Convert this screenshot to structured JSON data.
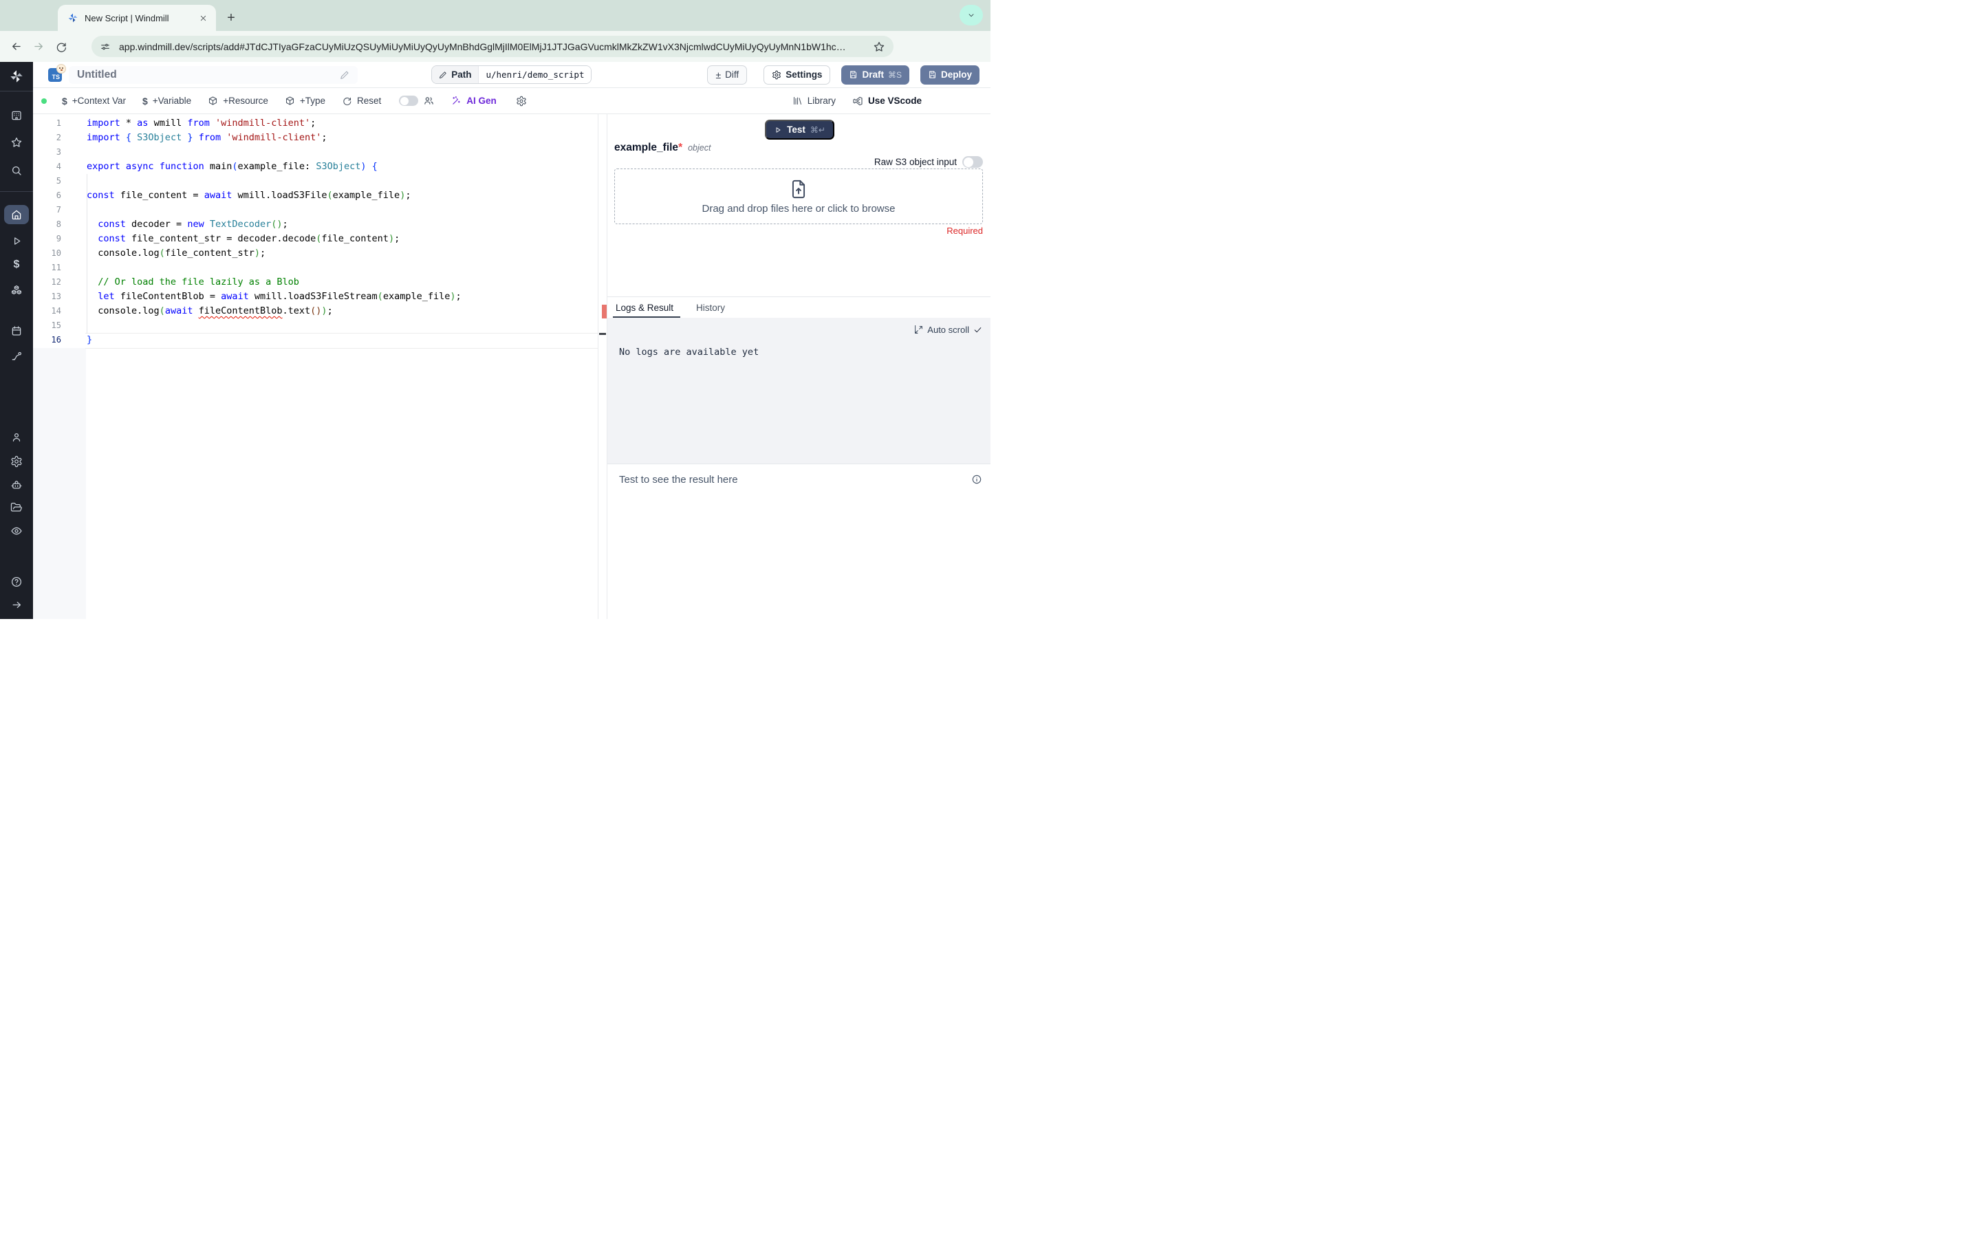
{
  "browser": {
    "tab_title": "New Script | Windmill",
    "url": "app.windmill.dev/scripts/add#JTdCJTIyaGFzaCUyMiUzQSUyMiUyMiUyQyUyMnBhdGglMjIlM0ElMjJ1JTJGaGVucmklMkZkZW1vX3NjcmlwdCUyMiUyQyUyMnN1bW1hc…"
  },
  "header": {
    "language_badge": "TS",
    "title": "Untitled",
    "path_label": "Path",
    "path_value": "u/henri/demo_script",
    "diff_label": "Diff",
    "settings_label": "Settings",
    "draft_label": "Draft",
    "draft_shortcut": "⌘S",
    "deploy_label": "Deploy"
  },
  "toolbar": {
    "context_var": "+Context Var",
    "variable": "+Variable",
    "resource": "+Resource",
    "type": "+Type",
    "reset": "Reset",
    "ai_gen": "AI Gen",
    "library": "Library",
    "vscode": "Use VScode"
  },
  "editor": {
    "cursor_line": 16,
    "error_line": 14,
    "lines": [
      [
        [
          "kw",
          "import"
        ],
        [
          "def",
          " * "
        ],
        [
          "kw",
          "as"
        ],
        [
          "def",
          " wmill "
        ],
        [
          "kw",
          "from"
        ],
        [
          "def",
          " "
        ],
        [
          "str",
          "'windmill-client'"
        ],
        [
          "def",
          ";"
        ]
      ],
      [
        [
          "kw",
          "import"
        ],
        [
          "p1",
          " { "
        ],
        [
          "type",
          "S3Object"
        ],
        [
          "p1",
          " } "
        ],
        [
          "kw",
          "from"
        ],
        [
          "def",
          " "
        ],
        [
          "str",
          "'windmill-client'"
        ],
        [
          "def",
          ";"
        ]
      ],
      [],
      [
        [
          "kw",
          "export"
        ],
        [
          "def",
          " "
        ],
        [
          "kw",
          "async"
        ],
        [
          "def",
          " "
        ],
        [
          "kw",
          "function"
        ],
        [
          "def",
          " main"
        ],
        [
          "p1",
          "("
        ],
        [
          "def",
          "example_file: "
        ],
        [
          "type",
          "S3Object"
        ],
        [
          "p1",
          ")"
        ],
        [
          "def",
          " "
        ],
        [
          "p1",
          "{"
        ]
      ],
      [],
      [
        [
          "kw",
          "const"
        ],
        [
          "def",
          " file_content = "
        ],
        [
          "kw",
          "await"
        ],
        [
          "def",
          " wmill.loadS3File"
        ],
        [
          "p2",
          "("
        ],
        [
          "def",
          "example_file"
        ],
        [
          "p2",
          ")"
        ],
        [
          "def",
          ";"
        ]
      ],
      [],
      [
        [
          "def",
          "  "
        ],
        [
          "kw",
          "const"
        ],
        [
          "def",
          " decoder = "
        ],
        [
          "kw",
          "new"
        ],
        [
          "def",
          " "
        ],
        [
          "type",
          "TextDecoder"
        ],
        [
          "p2",
          "()"
        ],
        [
          "def",
          ";"
        ]
      ],
      [
        [
          "def",
          "  "
        ],
        [
          "kw",
          "const"
        ],
        [
          "def",
          " file_content_str = decoder.decode"
        ],
        [
          "p2",
          "("
        ],
        [
          "def",
          "file_content"
        ],
        [
          "p2",
          ")"
        ],
        [
          "def",
          ";"
        ]
      ],
      [
        [
          "def",
          "  console.log"
        ],
        [
          "p2",
          "("
        ],
        [
          "def",
          "file_content_str"
        ],
        [
          "p2",
          ")"
        ],
        [
          "def",
          ";"
        ]
      ],
      [],
      [
        [
          "def",
          "  "
        ],
        [
          "cmt",
          "// Or load the file lazily as a Blob"
        ]
      ],
      [
        [
          "def",
          "  "
        ],
        [
          "kw",
          "let"
        ],
        [
          "def",
          " fileContentBlob = "
        ],
        [
          "kw",
          "await"
        ],
        [
          "def",
          " wmill.loadS3FileStream"
        ],
        [
          "p2",
          "("
        ],
        [
          "def",
          "example_file"
        ],
        [
          "p2",
          ")"
        ],
        [
          "def",
          ";"
        ]
      ],
      [
        [
          "def",
          "  console.log"
        ],
        [
          "p2",
          "("
        ],
        [
          "kw",
          "await"
        ],
        [
          "def",
          " "
        ],
        [
          "err",
          "fileContentBlob"
        ],
        [
          "def",
          ".text"
        ],
        [
          "p3",
          "()"
        ],
        [
          "p2",
          ")"
        ],
        [
          "def",
          ";"
        ]
      ],
      [],
      [
        [
          "p1",
          "}"
        ]
      ]
    ]
  },
  "right_panel": {
    "test_label": "Test",
    "test_shortcut": "⌘↵",
    "arg_name": "example_file",
    "required_star": "*",
    "arg_type": "object",
    "raw_s3_label": "Raw S3 object input",
    "dropzone_text": "Drag and drop files here or click to browse",
    "required_label": "Required",
    "tabs": [
      {
        "label": "Logs & Result",
        "active": true
      },
      {
        "label": "History",
        "active": false
      }
    ],
    "auto_scroll_label": "Auto scroll",
    "no_logs_text": "No logs are available yet",
    "result_placeholder": "Test to see the result here"
  },
  "colors": {
    "slate_button": "#66799e",
    "test_button": "#2e3a58",
    "ai_gen": "#6d28d9",
    "required_red": "#dc2626",
    "run_status_dot": "#4ade80",
    "error_marker": "#e8756d",
    "active_tab_underline": "#374151",
    "sidebar_bg": "#1c1f27",
    "browser_chrome": "#d2e1da"
  }
}
